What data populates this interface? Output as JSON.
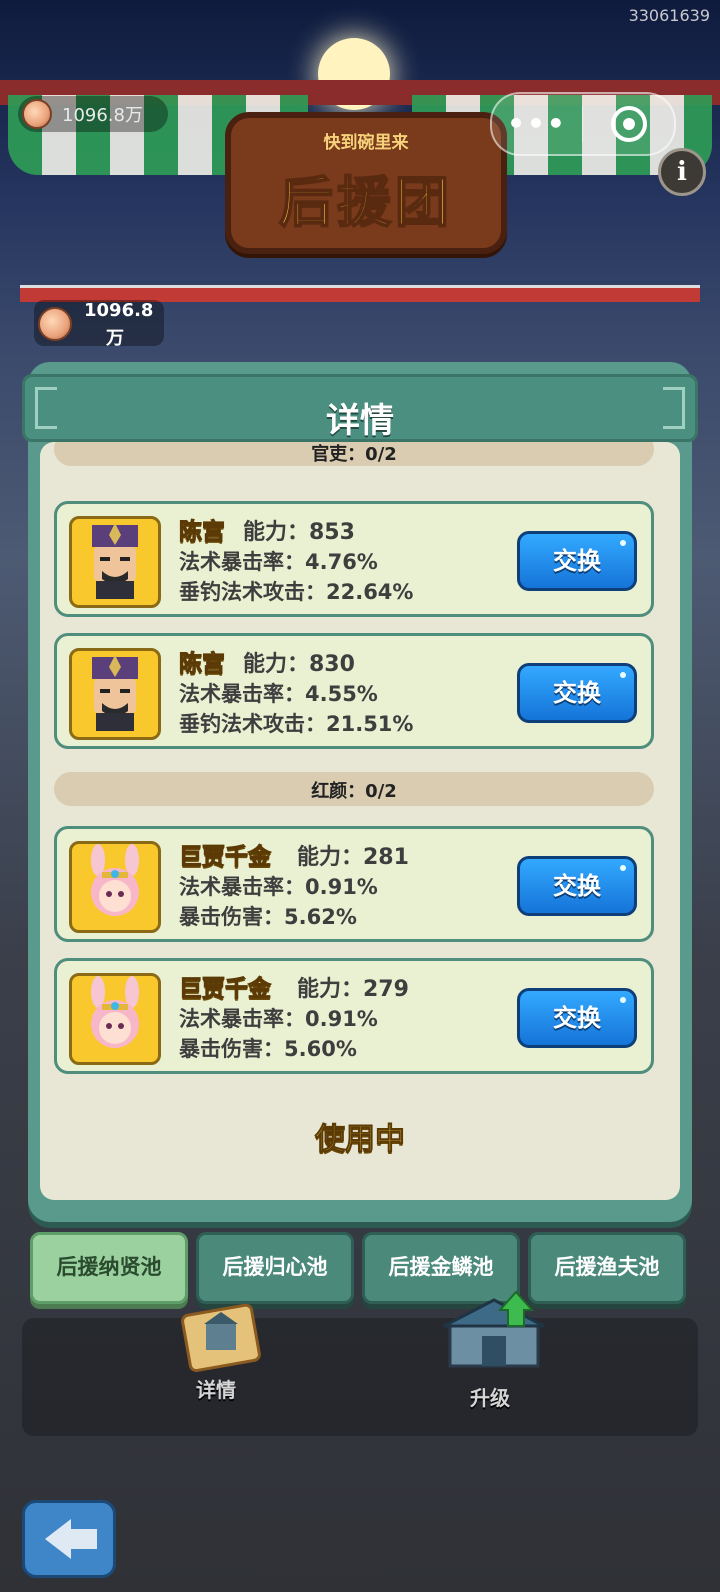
{
  "build_id": "33061639",
  "header": {
    "coin_amount": "1096.8万",
    "sign_subtitle": "快到碗里来",
    "sign_title": "后援团",
    "capsule_more": "•••",
    "info_symbol": "i"
  },
  "wallet": {
    "amount_line1": "1096.8",
    "amount_line2": "万"
  },
  "panel": {
    "title": "详情",
    "sections": [
      {
        "label": "官吏：0/2",
        "cards": [
          {
            "name": "陈宫",
            "power_label": "能力：853",
            "stat1": "法术暴击率：4.76%",
            "stat2": "垂钓法术攻击：22.64%",
            "button": "交换"
          },
          {
            "name": "陈宫",
            "power_label": "能力：830",
            "stat1": "法术暴击率：4.55%",
            "stat2": "垂钓法术攻击：21.51%",
            "button": "交换"
          }
        ]
      },
      {
        "label": "红颜：0/2",
        "cards": [
          {
            "name": "巨贾千金",
            "power_label": "能力：281",
            "stat1": "法术暴击率：0.91%",
            "stat2": "暴击伤害：5.62%",
            "button": "交换"
          },
          {
            "name": "巨贾千金",
            "power_label": "能力：279",
            "stat1": "法术暴击率：0.91%",
            "stat2": "暴击伤害：5.60%",
            "button": "交换"
          }
        ]
      }
    ],
    "status": "使用中"
  },
  "tabs": [
    "后援纳贤池",
    "后援归心池",
    "后援金鳞池",
    "后援渔夫池"
  ],
  "bottom": {
    "details_label": "详情",
    "upgrade_label": "升级"
  },
  "colors": {
    "panel_teal": "#5a9a8c",
    "panel_bg": "#e8e7d6",
    "swap_blue": "#1f8ff0",
    "name_yellow": "#ffe04a",
    "active_tab": "#9bd19f"
  },
  "icons": [
    "coin-icon",
    "wechat-more-icon",
    "wechat-close-icon",
    "info-icon",
    "scroll-icon",
    "upgrade-building-icon",
    "back-arrow-icon"
  ]
}
